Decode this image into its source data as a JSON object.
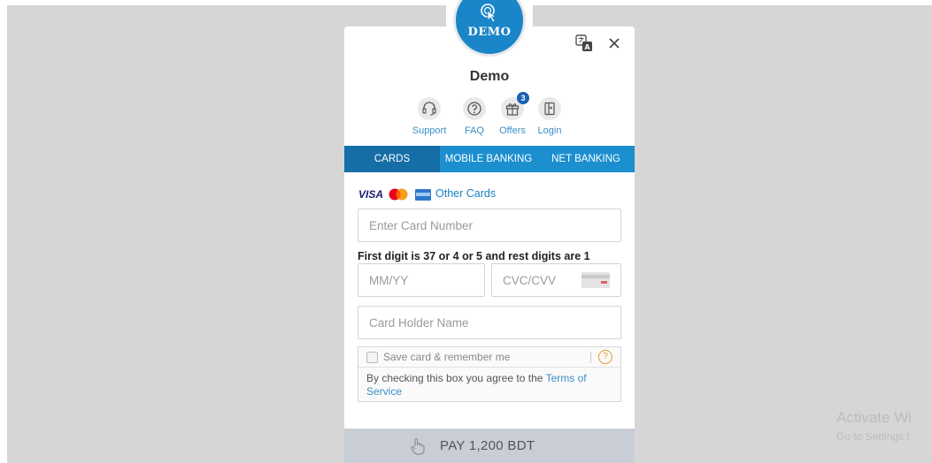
{
  "merchant": {
    "logo_text": "DEMO",
    "name": "Demo"
  },
  "quick_links": [
    {
      "label": "Support",
      "icon": "headset-icon"
    },
    {
      "label": "FAQ",
      "icon": "question-icon"
    },
    {
      "label": "Offers",
      "icon": "gift-icon",
      "badge": "3"
    },
    {
      "label": "Login",
      "icon": "login-icon"
    }
  ],
  "tabs": [
    {
      "label": "CARDS",
      "active": true
    },
    {
      "label": "MOBILE BANKING",
      "active": false
    },
    {
      "label": "NET BANKING",
      "active": false
    }
  ],
  "card_brands": {
    "visa": "VISA",
    "other_cards": "Other Cards"
  },
  "form": {
    "card_number_placeholder": "Enter Card Number",
    "hint": "First digit is 37 or 4 or 5 and rest digits are 1",
    "expiry_placeholder": "MM/YY",
    "cvc_placeholder": "CVC/CVV",
    "holder_placeholder": "Card Holder Name",
    "save_label": "Save card & remember me",
    "help": "?",
    "agree_text": "By checking this box you agree to the ",
    "terms_link": "Terms of Service"
  },
  "pay": {
    "label": "PAY 1,200 BDT"
  },
  "watermark": {
    "title": "Activate Wi",
    "subtitle": "Go to Settings t"
  },
  "colors": {
    "accent": "#1c8fcf",
    "active_tab": "#166ea7",
    "link": "#3a8fc8",
    "pay_button": "#c9ced6"
  }
}
